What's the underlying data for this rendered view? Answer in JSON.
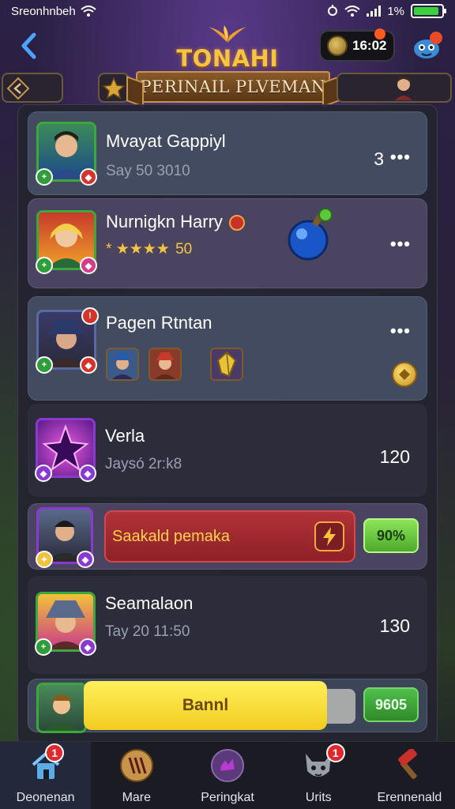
{
  "status_bar": {
    "carrier": "Sreonhnbeh",
    "battery_text": "1%",
    "battery_level": 0.9
  },
  "header": {
    "logo_text": "TONAHI",
    "coin_value": "16:02",
    "banner_title": "PERINAIL PLVEMAN"
  },
  "cards": [
    {
      "name": "Mvayat Gappiyl",
      "sub": "Say 50 3010",
      "value": "3",
      "more": "•••"
    },
    {
      "name": "Nurnigkn Harry",
      "stars_value": "50",
      "stars_prefix": "*",
      "more": "•••"
    },
    {
      "name": "Pagen Rtntan",
      "more": "•••"
    },
    {
      "name": "Verla",
      "sub": "Jaysó 2r:k8",
      "value": "120"
    },
    {
      "reward_label": "Saakald pemaka",
      "button": "90%"
    },
    {
      "name": "Seamalaon",
      "sub": "Tay 20 11:50",
      "value": "130"
    },
    {
      "bar_label": "Bannl",
      "button": "9605"
    }
  ],
  "bottom_nav": {
    "items": [
      {
        "label": "Deonenan",
        "badge": "1",
        "icon": "home-icon"
      },
      {
        "label": "Mare",
        "icon": "guild-icon"
      },
      {
        "label": "Peringkat",
        "icon": "ranking-icon"
      },
      {
        "label": "Urits",
        "badge": "1",
        "icon": "pet-icon"
      },
      {
        "label": "Erennenald",
        "icon": "hammer-icon"
      }
    ]
  },
  "colors": {
    "accent_gold": "#f5c542",
    "panel": "#242430",
    "green_button": "#6acb3a",
    "reward_red": "#b23238"
  }
}
